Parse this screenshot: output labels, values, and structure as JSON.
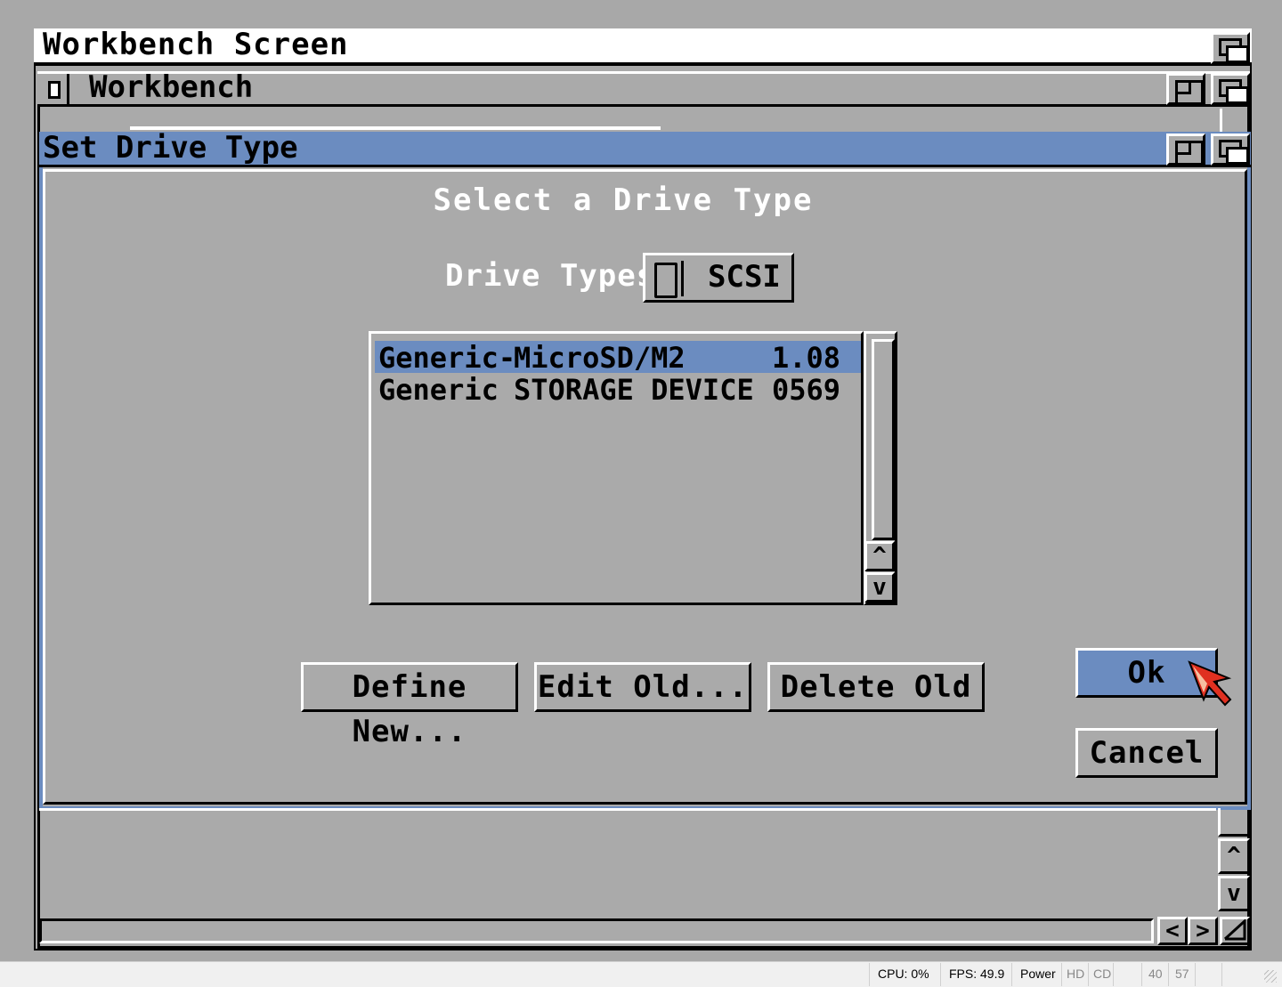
{
  "screen": {
    "title": "Workbench Screen"
  },
  "workbench_window": {
    "title": "Workbench"
  },
  "requester": {
    "title": "Set Drive Type",
    "heading": "Select a Drive Type",
    "drive_types_label": "Drive Types:",
    "drive_types_value": "SCSI",
    "list": [
      {
        "vendor": "Generic-",
        "product": "MicroSD/M2",
        "revision": "1.08",
        "selected": true
      },
      {
        "vendor": "Generic",
        "product": "STORAGE DEVICE",
        "revision": "0569",
        "selected": false
      }
    ],
    "buttons": {
      "define_new": "Define New...",
      "edit_old": "Edit Old...",
      "delete_old": "Delete Old",
      "ok": "Ok",
      "cancel": "Cancel"
    }
  },
  "host_status": {
    "cpu": "CPU: 0%",
    "fps": "FPS: 49.9",
    "power": "Power",
    "hd": "HD",
    "cd": "CD",
    "n1": "40",
    "n2": "57"
  },
  "colors": {
    "screen_gray": "#aaaaaa",
    "amiga_blue": "#6b8cc0",
    "white": "#ffffff",
    "black": "#000000",
    "pointer_red": "#e03020"
  }
}
